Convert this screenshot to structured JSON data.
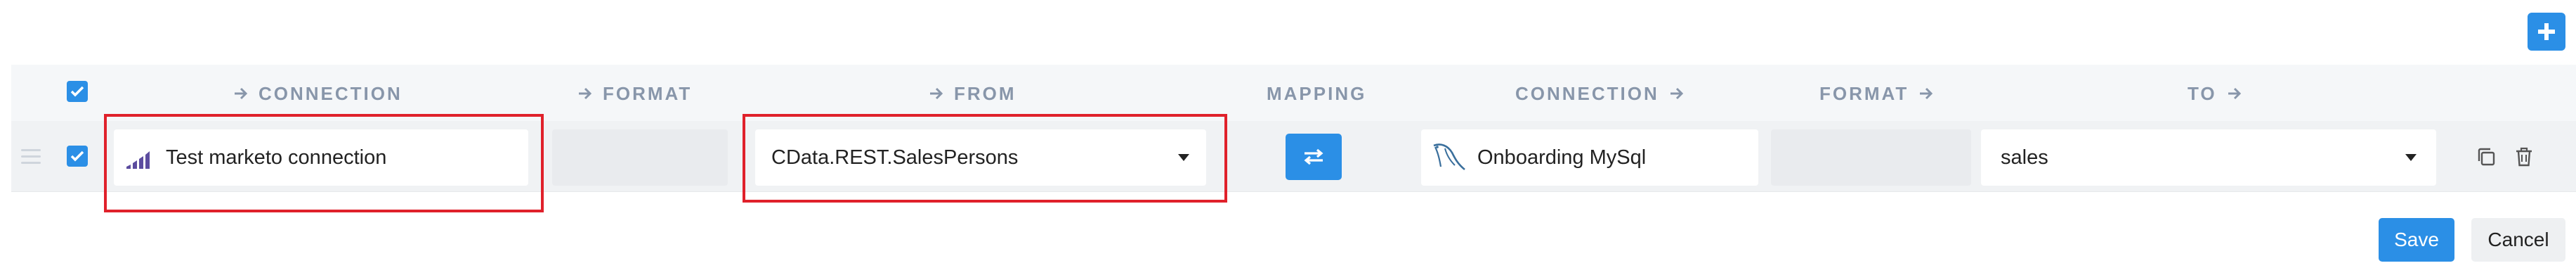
{
  "toolbar": {
    "add_icon": "plus-icon"
  },
  "columns": {
    "source_connection": "CONNECTION",
    "source_format": "FORMAT",
    "from": "FROM",
    "mapping": "MAPPING",
    "dest_connection": "CONNECTION",
    "dest_format": "FORMAT",
    "to": "TO"
  },
  "row": {
    "checked": true,
    "source_connection": {
      "label": "Test marketo connection",
      "icon": "marketo-logo-icon"
    },
    "source_format": "",
    "from": {
      "value": "CData.REST.SalesPersons"
    },
    "mapping_icon": "swap-arrows-icon",
    "dest_connection": {
      "label": "Onboarding MySql",
      "icon": "mysql-logo-icon"
    },
    "dest_format": "",
    "to": {
      "value": "sales"
    }
  },
  "actions": {
    "save": "Save",
    "cancel": "Cancel"
  },
  "colors": {
    "accent": "#2b8fe6",
    "highlight": "#e0212b",
    "header_text": "#8896aa"
  }
}
